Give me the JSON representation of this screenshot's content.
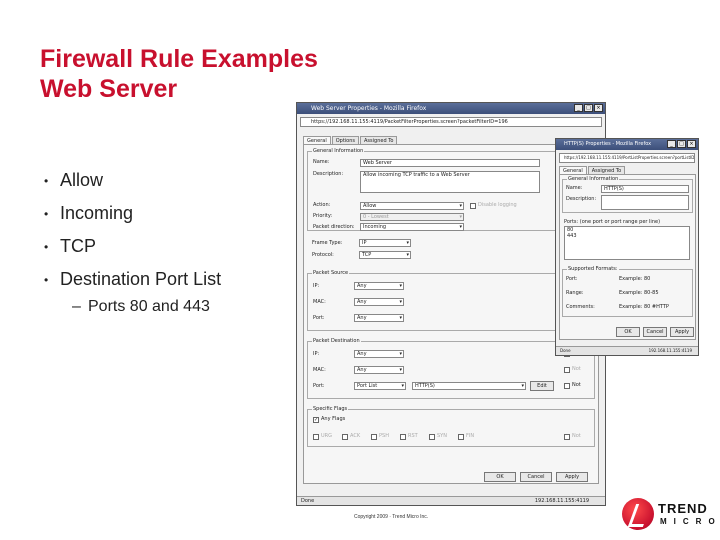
{
  "slide": {
    "title_line1": "Firewall Rule Examples",
    "title_line2": "Web Server",
    "bullets": [
      "Allow",
      "Incoming",
      "TCP",
      "Destination Port List"
    ],
    "sub_bullet": "Ports 80 and 443",
    "footer": "Copyright 2009 · Trend Micro Inc.",
    "logo_word1": "TREND",
    "logo_word2": "MICRO"
  },
  "main_window": {
    "title": "Web Server Properties - Mozilla Firefox",
    "address": "https://192.168.11.155:4119/PacketFilterProperties.screen?packetFilterID=196",
    "tabs": [
      "General",
      "Options",
      "Assigned To"
    ],
    "general_info": {
      "section": "General Information",
      "name_label": "Name:",
      "name_value": "Web Server",
      "description_label": "Description:",
      "description_value": "Allow incoming TCP traffic to a Web Server"
    },
    "action_label": "Action:",
    "action_value": "Allow",
    "disable_label": "Disable logging",
    "priority_label": "Priority:",
    "priority_value": "0 - Lowest",
    "direction_label": "Packet direction:",
    "direction_value": "Incoming",
    "frame_type_label": "Frame Type:",
    "frame_type_value": "IP",
    "protocol_label": "Protocol:",
    "protocol_value": "TCP",
    "packet_source": {
      "section": "Packet Source",
      "ip_label": "IP:",
      "ip_value": "Any",
      "mac_label": "MAC:",
      "mac_value": "Any",
      "port_label": "Port:",
      "port_value": "Any"
    },
    "packet_destination": {
      "section": "Packet Destination",
      "ip_label": "IP:",
      "ip_value": "Any",
      "mac_label": "MAC:",
      "mac_value": "Any",
      "port_label": "Port:",
      "port_value": "Port List",
      "port_list_value": "HTTP(S)",
      "edit_label": "Edit",
      "not_label": "Not"
    },
    "specific_flags": {
      "section": "Specific Flags",
      "any_flags_label": "Any Flags",
      "flags": [
        "URG",
        "ACK",
        "PSH",
        "RST",
        "SYN",
        "FIN"
      ]
    },
    "ok_label": "OK",
    "cancel_label": "Cancel",
    "apply_label": "Apply",
    "status_left": "Done",
    "status_right": "192.168.11.155:4119"
  },
  "overlay_window": {
    "title": "HTTP(S) Properties - Mozilla Firefox",
    "address": "https://192.168.11.155:4119/PortListProperties.screen?portListID=3",
    "tabs": [
      "General",
      "Assigned To"
    ],
    "section_general": "General Information",
    "name_label": "Name:",
    "name_value": "HTTP(S)",
    "description_label": "Description:",
    "ports_heading": "Ports: (one port or port range per line)",
    "ports": [
      "80",
      "443"
    ],
    "supported_formats": "Supported Formats:",
    "formats": [
      {
        "label": "Port:",
        "example": "Example: 80"
      },
      {
        "label": "Range:",
        "example": "Example: 80-85"
      },
      {
        "label": "Comments:",
        "example": "Example: 80 #HTTP"
      }
    ],
    "ok_label": "OK",
    "cancel_label": "Cancel",
    "apply_label": "Apply",
    "status_left": "Done",
    "status_right": "192.168.11.155:4119"
  }
}
